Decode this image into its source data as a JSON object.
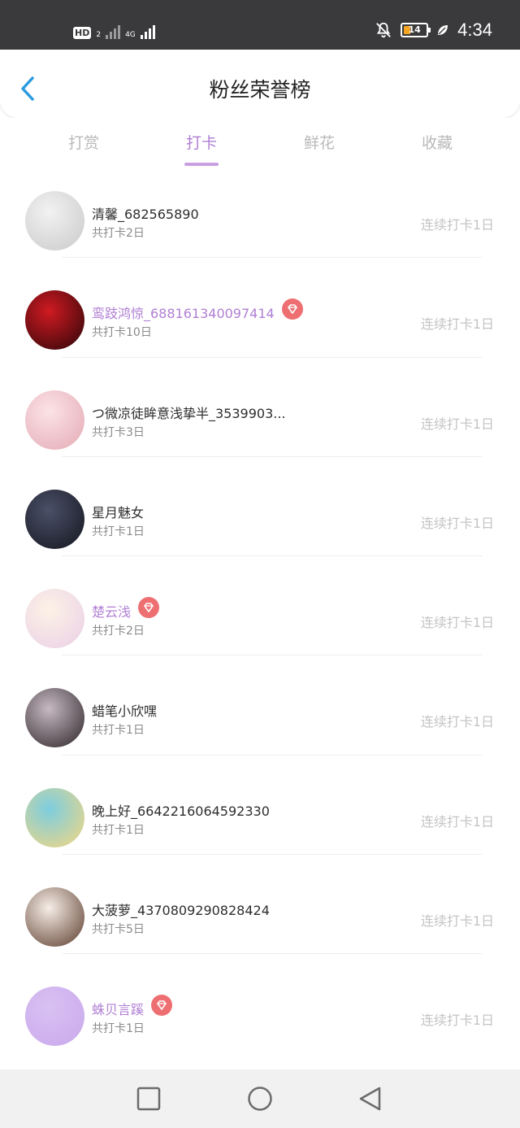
{
  "status_bar": {
    "hd": "HD",
    "hd_sub": "2",
    "network": "4G",
    "battery": "14",
    "time": "4:34"
  },
  "header": {
    "title": "粉丝荣誉榜"
  },
  "tabs": [
    {
      "label": "打赏",
      "active": false
    },
    {
      "label": "打卡",
      "active": true
    },
    {
      "label": "鲜花",
      "active": false
    },
    {
      "label": "收藏",
      "active": false
    }
  ],
  "fans": [
    {
      "name": "清馨_682565890",
      "vip": false,
      "total": "共打卡2日",
      "streak": "连续打卡1日",
      "avatar_colors": [
        "#f2f2f2",
        "#c9c9c9"
      ]
    },
    {
      "name": "鸾跂鸿惊_688161340097414",
      "vip": true,
      "total": "共打卡10日",
      "streak": "连续打卡1日",
      "avatar_colors": [
        "#d01a22",
        "#2a0608"
      ]
    },
    {
      "name": "つ微凉徒眸意浅挚半_3539903...",
      "vip": false,
      "total": "共打卡3日",
      "streak": "连续打卡1日",
      "avatar_colors": [
        "#fbe3e7",
        "#e4a9b4"
      ]
    },
    {
      "name": "星月魅女",
      "vip": false,
      "total": "共打卡1日",
      "streak": "连续打卡1日",
      "avatar_colors": [
        "#4a5068",
        "#14151d"
      ]
    },
    {
      "name": "楚云浅",
      "vip": true,
      "total": "共打卡2日",
      "streak": "连续打卡1日",
      "avatar_colors": [
        "#fdf2e6",
        "#e9cfe6"
      ]
    },
    {
      "name": "蜡笔小欣嘿",
      "vip": false,
      "total": "共打卡1日",
      "streak": "连续打卡1日",
      "avatar_colors": [
        "#c7b9c2",
        "#2b2327"
      ]
    },
    {
      "name": "晚上好_6642216064592330",
      "vip": false,
      "total": "共打卡1日",
      "streak": "连续打卡1日",
      "avatar_colors": [
        "#7ccde0",
        "#f6d77f"
      ]
    },
    {
      "name": "大菠萝_4370809290828424",
      "vip": false,
      "total": "共打卡5日",
      "streak": "连续打卡1日",
      "avatar_colors": [
        "#f7eee7",
        "#5a3a2b"
      ]
    },
    {
      "name": "蛛贝言蹊",
      "vip": true,
      "total": "共打卡1日",
      "streak": "连续打卡1日",
      "avatar_colors": [
        "#d9c1f2",
        "#c9a8ec"
      ]
    }
  ],
  "colors": {
    "accent": "#b07fd4",
    "vip_badge": "#ee6f72",
    "back_arrow": "#2a9bde",
    "status_bar": "#3a3a3c"
  },
  "icons": {
    "back": "chevron-left-icon",
    "vip": "diamond-icon",
    "silent": "bell-off-icon",
    "power_saving": "leaf-icon",
    "recent_apps": "square-icon",
    "home": "circle-icon",
    "back_nav": "triangle-back-icon"
  }
}
